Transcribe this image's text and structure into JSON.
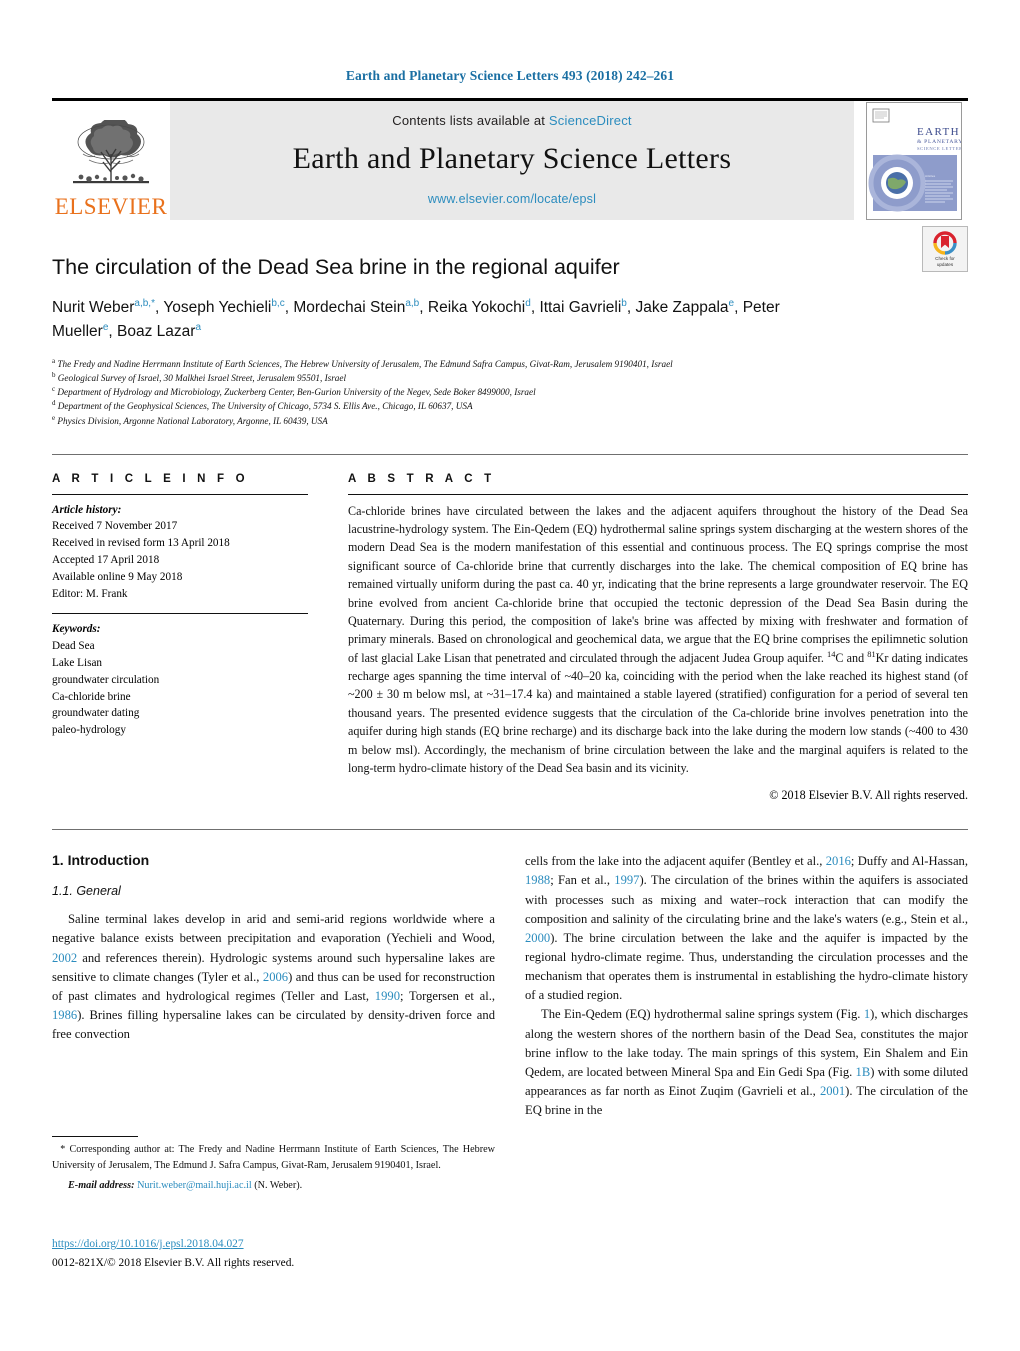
{
  "running_head": "Earth and Planetary Science Letters 493 (2018) 242–261",
  "masthead": {
    "publisher_name": "ELSEVIER",
    "contents_prefix": "Contents lists available at ",
    "contents_link": "ScienceDirect",
    "journal_title": "Earth and Planetary Science Letters",
    "journal_url": "www.elsevier.com/locate/epsl",
    "cover": {
      "line1": "EARTH",
      "line2": "& PLANETARY",
      "line3": "SCIENCE LETTERS"
    },
    "link_color": "#2b8cbe",
    "brand_color": "#E9711C"
  },
  "article": {
    "title": "The circulation of the Dead Sea brine in the regional aquifer",
    "authors": [
      {
        "name": "Nurit Weber",
        "sup": "a,b,*"
      },
      {
        "name": "Yoseph Yechieli",
        "sup": "b,c"
      },
      {
        "name": "Mordechai Stein",
        "sup": "a,b"
      },
      {
        "name": "Reika Yokochi",
        "sup": "d"
      },
      {
        "name": "Ittai Gavrieli",
        "sup": "b"
      },
      {
        "name": "Jake Zappala",
        "sup": "e"
      },
      {
        "name": "Peter Mueller",
        "sup": "e"
      },
      {
        "name": "Boaz Lazar",
        "sup": "a"
      }
    ],
    "affiliations": [
      {
        "marker": "a",
        "text": "The Fredy and Nadine Herrmann Institute of Earth Sciences, The Hebrew University of Jerusalem, The Edmund Safra Campus, Givat-Ram, Jerusalem 9190401, Israel"
      },
      {
        "marker": "b",
        "text": "Geological Survey of Israel, 30 Malkhei Israel Street, Jerusalem 95501, Israel"
      },
      {
        "marker": "c",
        "text": "Department of Hydrology and Microbiology, Zuckerberg Center, Ben-Gurion University of the Negev, Sede Boker 8499000, Israel"
      },
      {
        "marker": "d",
        "text": "Department of the Geophysical Sciences, The University of Chicago, 5734 S. Ellis Ave., Chicago, IL 60637, USA"
      },
      {
        "marker": "e",
        "text": "Physics Division, Argonne National Laboratory, Argonne, IL 60439, USA"
      }
    ],
    "crossmark": {
      "line1": "Check for",
      "line2": "updates"
    }
  },
  "article_info": {
    "heading": "A R T I C L E    I N F O",
    "history_label": "Article history:",
    "history": [
      "Received 7 November 2017",
      "Received in revised form 13 April 2018",
      "Accepted 17 April 2018",
      "Available online 9 May 2018",
      "Editor: M. Frank"
    ],
    "keywords_label": "Keywords:",
    "keywords": [
      "Dead Sea",
      "Lake Lisan",
      "groundwater circulation",
      "Ca-chloride brine",
      "groundwater dating",
      "paleo-hydrology"
    ]
  },
  "abstract": {
    "heading": "A B S T R A C T",
    "part1": "Ca-chloride brines have circulated between the lakes and the adjacent aquifers throughout the history of the Dead Sea lacustrine-hydrology system. The Ein-Qedem (EQ) hydrothermal saline springs system discharging at the western shores of the modern Dead Sea is the modern manifestation of this essential and continuous process. The EQ springs comprise the most significant source of Ca-chloride brine that currently discharges into the lake. The chemical composition of EQ brine has remained virtually uniform during the past ca. 40 yr, indicating that the brine represents a large groundwater reservoir. The EQ brine evolved from ancient Ca-chloride brine that occupied the tectonic depression of the Dead Sea Basin during the Quaternary. During this period, the composition of lake's brine was affected by mixing with freshwater and formation of primary minerals. Based on chronological and geochemical data, we argue that the EQ brine comprises the epilimnetic solution of last glacial Lake Lisan that penetrated and circulated through the adjacent Judea Group aquifer. ",
    "sup1": "14",
    "mid1": "C and ",
    "sup2": "81",
    "part2": "Kr dating indicates recharge ages spanning the time interval of ~40–20 ka, coinciding with the period when the lake reached its highest stand (of ~200 ± 30 m below msl, at ~31–17.4 ka) and maintained a stable layered (stratified) configuration for a period of several ten thousand years. The presented evidence suggests that the circulation of the Ca-chloride brine involves penetration into the aquifer during high stands (EQ brine recharge) and its discharge back into the lake during the modern low stands (~400 to 430 m below msl). Accordingly, the mechanism of brine circulation between the lake and the marginal aquifers is related to the long-term hydro-climate history of the Dead Sea basin and its vicinity.",
    "copyright": "© 2018 Elsevier B.V. All rights reserved."
  },
  "body": {
    "section_heading": "1. Introduction",
    "subsection_heading": "1.1. General",
    "left_p1_a": "Saline terminal lakes develop in arid and semi-arid regions worldwide where a negative balance exists between precipitation and evaporation (Yechieli and Wood, ",
    "left_ref1": "2002",
    "left_p1_b": " and references therein). Hydrologic systems around such hypersaline lakes are sensitive to climate changes (Tyler et al., ",
    "left_ref2": "2006",
    "left_p1_c": ") and thus can be used for reconstruction of past climates and hydrological regimes (Teller and Last, ",
    "left_ref3": "1990",
    "left_p1_d": "; Torgersen et al., ",
    "left_ref4": "1986",
    "left_p1_e": "). Brines filling hypersaline lakes can be circulated by density-driven force and free convection",
    "right_p1_a": "cells from the lake into the adjacent aquifer (Bentley et al., ",
    "right_ref1": "2016",
    "right_p1_b": "; Duffy and Al-Hassan, ",
    "right_ref2": "1988",
    "right_p1_c": "; Fan et al., ",
    "right_ref3": "1997",
    "right_p1_d": "). The circulation of the brines within the aquifers is associated with processes such as mixing and water–rock interaction that can modify the composition and salinity of the circulating brine and the lake's waters (e.g., Stein et al., ",
    "right_ref4": "2000",
    "right_p1_e": "). The brine circulation between the lake and the aquifer is impacted by the regional hydro-climate regime. Thus, understanding the circulation processes and the mechanism that operates them is instrumental in establishing the hydro-climate history of a studied region.",
    "right_p2_a": "The Ein-Qedem (EQ) hydrothermal saline springs system (Fig. ",
    "right_ref5": "1",
    "right_p2_b": "), which discharges along the western shores of the northern basin of the Dead Sea, constitutes the major brine inflow to the lake today. The main springs of this system, Ein Shalem and Ein Qedem, are located between Mineral Spa and Ein Gedi Spa (Fig. ",
    "right_ref6": "1B",
    "right_p2_c": ") with some diluted appearances as far north as Einot Zuqim (Gavrieli et al., ",
    "right_ref7": "2001",
    "right_p2_d": "). The circulation of the EQ brine in the"
  },
  "footnotes": {
    "corresponding_marker": "*",
    "corresponding": "Corresponding author at: The Fredy and Nadine Herrmann Institute of Earth Sciences, The Hebrew University of Jerusalem, The Edmund J. Safra Campus, Givat-Ram, Jerusalem 9190401, Israel.",
    "email_label": "E-mail address:",
    "email": "Nurit.weber@mail.huji.ac.il",
    "email_suffix": "(N. Weber).",
    "doi": "https://doi.org/10.1016/j.epsl.2018.04.027",
    "issn_line": "0012-821X/© 2018 Elsevier B.V. All rights reserved."
  }
}
